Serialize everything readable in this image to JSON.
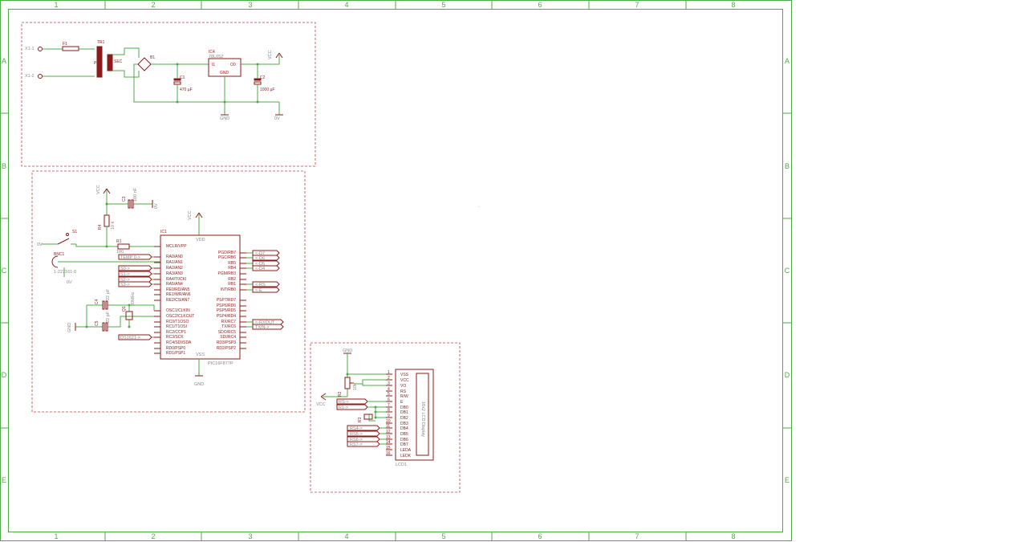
{
  "frame": {
    "columns": [
      "1",
      "2",
      "3",
      "4",
      "5",
      "6",
      "7",
      "8"
    ],
    "rows": [
      "A",
      "B",
      "C",
      "D",
      "E"
    ]
  },
  "psu": {
    "x1_1": "X1-1",
    "x1_2": "X1-2",
    "f1": "F1",
    "tr1": "TR1",
    "tr1_p": "PRI",
    "tr1_s": "SEC",
    "b1": "B1",
    "ic4": "IC4",
    "ic4_type": "78L05Z",
    "ic4_in": "I1",
    "ic4_out": "O0",
    "ic4_gnd": "GND",
    "c1": "C1",
    "c1_val": "470 µF",
    "c2": "C2",
    "c2_val": "1000 µF",
    "vcc": "VCC",
    "gnd": "GND",
    "zero_v": "0V"
  },
  "mcu": {
    "vcc1": "VCC",
    "c3": "C3",
    "c3_val": "100 nF",
    "zero_v_c3": "0V",
    "r4": "R4",
    "r4_val": "10 k",
    "s1": "S1",
    "zero_v_s1": "0V",
    "r1": "R1",
    "r1_val": "100",
    "bnc": "BNC1",
    "bnc_part": "1-227161-0",
    "zero_v_bnc": "0V",
    "vcc2": "VCC",
    "vdd_top": "VDD",
    "ic1": "IC1",
    "ic1_type": "PIC16F877P",
    "vss": "VSS",
    "gnd": "GND",
    "gnd_left": "GND",
    "c4": "C4",
    "c4_val": "22 pF",
    "c5": "C5",
    "c5_val": "22 pF",
    "q1": "Q1",
    "q1_val": "20MHz",
    "left_pins": [
      "MCLR/VPP",
      "RA0/AN0",
      "RA1/AN1",
      "RA2/AN2",
      "RA3/AN3",
      "RA4/T0CKI",
      "RA5/AN4",
      "RE0/RD/AN5",
      "RE1/WR/AN6",
      "RE2/CS/AN7",
      "OSC1/CLKIN",
      "OSC2/CLKOUT",
      "RC0/T1OSO",
      "RC1/T1OSI",
      "RC2/CCP1",
      "RC3/SCK",
      "RC4/SDI/SDA",
      "RD0/PSP0",
      "RD1/PSP1"
    ],
    "right_pins": [
      "PGD/RB7",
      "PGC/RB6",
      "RB5",
      "RB4",
      "PGM/RB3",
      "RB2",
      "RB1",
      "INT/RB0",
      "PSP7/RD7",
      "PSP6/RD6",
      "PSP5/RD5",
      "PSP4/RD4",
      "RX/RC7",
      "TX/RC6",
      "SDO/RC5",
      "SDI/RC4",
      "RD3/PSP3",
      "RD2/PSP2"
    ],
    "left_labels": [
      "TEMP 0->",
      "S0->",
      "S1->",
      "S2->",
      "S3->",
      "DS1621->"
    ],
    "right_labels": [
      "<-D7",
      "<-D6",
      "<-D5",
      "<-D4",
      "<-RS",
      "<-E",
      "<-RXOUT",
      "TXIN->"
    ]
  },
  "lcd": {
    "gnd": "GND",
    "vcc": "VCC",
    "r2": "R2",
    "r2_val": "10k",
    "r3": "R3",
    "r3_val": "100",
    "pins": [
      "VSS",
      "VCC",
      "VO",
      "RS",
      "R/W",
      "E",
      "DB0",
      "DB1",
      "DB2",
      "DB3",
      "DB4",
      "DB5",
      "DB6",
      "DB7",
      "LEDA",
      "LEDK"
    ],
    "pin_nums": [
      "1",
      "2",
      "3",
      "4",
      "5",
      "6",
      "7",
      "8",
      "9",
      "10",
      "11",
      "12",
      "13",
      "14",
      "15",
      "16"
    ],
    "labels": [
      "RS->",
      "R1->",
      "RS4->",
      "RS5->",
      "RS6->",
      "RS7->"
    ],
    "panel": "16x2 LCD Display",
    "ref": "LCD1"
  },
  "misc": {
    "stray": "-"
  }
}
